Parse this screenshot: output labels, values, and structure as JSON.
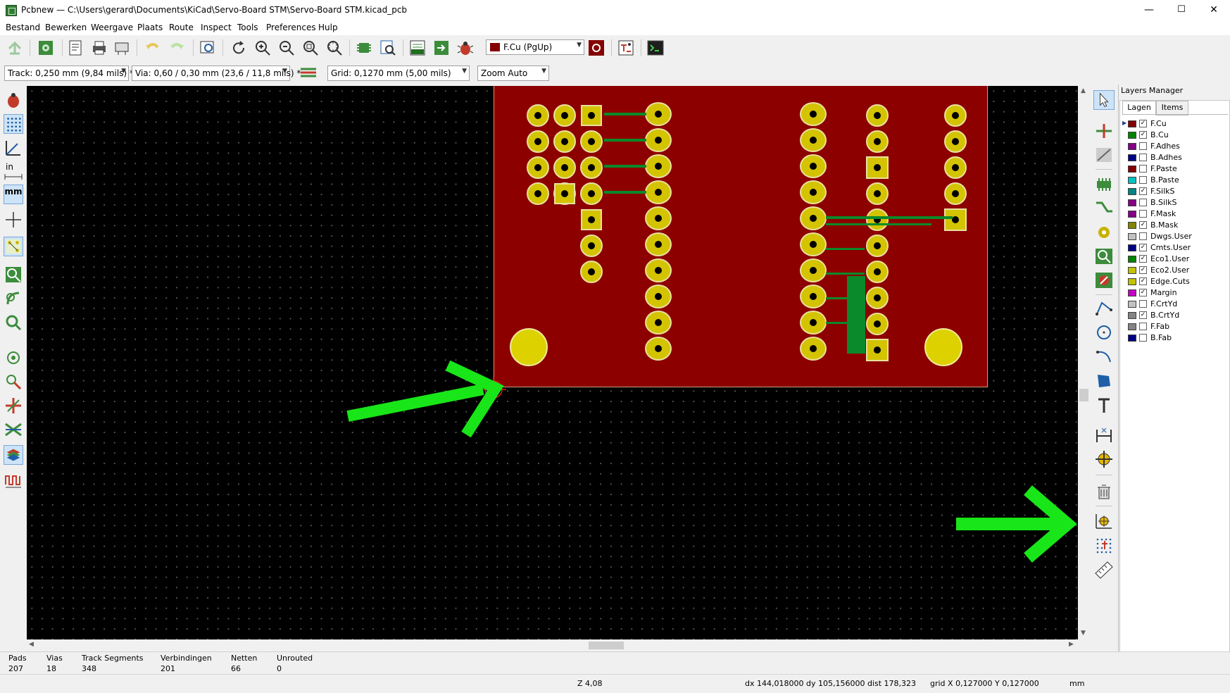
{
  "window": {
    "title": "Pcbnew — C:\\Users\\gerard\\Documents\\KiCad\\Servo-Board STM\\Servo-Board STM.kicad_pcb",
    "minimize": "—",
    "maximize": "☐",
    "close": "✕"
  },
  "menu": [
    "Bestand",
    "Bewerken",
    "Weergave",
    "Plaats",
    "Route",
    "Inspect",
    "Tools",
    "Preferences",
    "Hulp"
  ],
  "toolbar": {
    "active_layer": "F.Cu (PgUp)"
  },
  "toolbar2": {
    "track": "Track: 0,250 mm (9,84 mils) *",
    "via": "Via: 0,60 / 0,30 mm (23,6 / 11,8 mils) *",
    "grid": "Grid: 0,1270 mm (5,00 mils)",
    "zoom": "Zoom Auto"
  },
  "left_toolbar": {
    "units_in": "in",
    "units_mm": "mm"
  },
  "layers_manager": {
    "title": "Layers Manager",
    "tabs": [
      "Lagen",
      "Items"
    ],
    "layers": [
      {
        "name": "F.Cu",
        "color": "#840000",
        "checked": true
      },
      {
        "name": "B.Cu",
        "color": "#008400",
        "checked": true
      },
      {
        "name": "F.Adhes",
        "color": "#840084",
        "checked": false
      },
      {
        "name": "B.Adhes",
        "color": "#000084",
        "checked": false
      },
      {
        "name": "F.Paste",
        "color": "#840000",
        "checked": false
      },
      {
        "name": "B.Paste",
        "color": "#00c2c2",
        "checked": false
      },
      {
        "name": "F.SilkS",
        "color": "#008484",
        "checked": true
      },
      {
        "name": "B.SilkS",
        "color": "#840084",
        "checked": false
      },
      {
        "name": "F.Mask",
        "color": "#840084",
        "checked": false
      },
      {
        "name": "B.Mask",
        "color": "#848400",
        "checked": true
      },
      {
        "name": "Dwgs.User",
        "color": "#c2c2c2",
        "checked": false
      },
      {
        "name": "Cmts.User",
        "color": "#000084",
        "checked": true
      },
      {
        "name": "Eco1.User",
        "color": "#008400",
        "checked": true
      },
      {
        "name": "Eco2.User",
        "color": "#c2c200",
        "checked": true
      },
      {
        "name": "Edge.Cuts",
        "color": "#c2c200",
        "checked": true
      },
      {
        "name": "Margin",
        "color": "#c200c2",
        "checked": true
      },
      {
        "name": "F.CrtYd",
        "color": "#c2c2c2",
        "checked": false
      },
      {
        "name": "B.CrtYd",
        "color": "#848484",
        "checked": true
      },
      {
        "name": "F.Fab",
        "color": "#848484",
        "checked": false
      },
      {
        "name": "B.Fab",
        "color": "#000084",
        "checked": false
      }
    ]
  },
  "status": {
    "pads_label": "Pads",
    "pads": "207",
    "vias_label": "Vias",
    "vias": "18",
    "track_label": "Track Segments",
    "track": "348",
    "verb_label": "Verbindingen",
    "verb": "201",
    "netten_label": "Netten",
    "netten": "66",
    "unrouted_label": "Unrouted",
    "unrouted": "0",
    "zoom": "Z 4,08",
    "delta": "dx 144,018000  dy 105,156000  dist 178,323",
    "grid": "grid X 0,127000  Y 0,127000",
    "units": "mm"
  },
  "colors": {
    "board_fill": "#8d0000",
    "pad": "#d4c300",
    "b_cu_track": "#0a8a2a",
    "annotation_arrow": "#19e619",
    "canvas_bg": "#000000"
  }
}
